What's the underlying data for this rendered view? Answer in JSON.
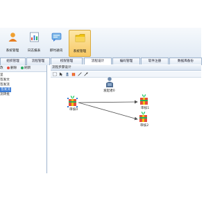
{
  "toolbar": {
    "buttons": [
      {
        "label": "系统管理",
        "icon": "user-icon"
      },
      {
        "label": "日志报表",
        "icon": "report-icon"
      },
      {
        "label": "即时通讯",
        "icon": "chat-icon"
      },
      {
        "label": "系统管理",
        "icon": "folder-icon",
        "active": true
      }
    ]
  },
  "tabs": [
    {
      "label": "组织管理"
    },
    {
      "label": "流程管理"
    },
    {
      "label": "权限管理"
    },
    {
      "label": "流程设计",
      "active": true
    },
    {
      "label": "编码管理"
    },
    {
      "label": "软件注册"
    },
    {
      "label": "数据库备份"
    }
  ],
  "left_panel": {
    "toolbar": [
      {
        "label": "改",
        "icon": "edit-icon"
      },
      {
        "label": "删除",
        "icon": "delete-icon"
      },
      {
        "label": "刷新",
        "icon": "refresh-icon"
      }
    ],
    "tree": [
      {
        "label": "呈"
      },
      {
        "label": "签发文"
      },
      {
        "label": "签发流"
      },
      {
        "label": "签发流",
        "selected": true
      },
      {
        "label": "流转批"
      }
    ]
  },
  "designer": {
    "title": "流程步骤设计",
    "tools": [
      "select-icon",
      "pointer-icon",
      "start-node-icon",
      "task-node-icon",
      "line-icon",
      "arrow-icon"
    ],
    "nodes": [
      {
        "id": "start",
        "label": "发起者0",
        "icon": "person-icon"
      },
      {
        "id": "a0",
        "label": "审核0",
        "icon": "gift-icon"
      },
      {
        "id": "a1",
        "label": "审核1",
        "icon": "gift-icon"
      },
      {
        "id": "a2",
        "label": "审核2",
        "icon": "gift-icon"
      }
    ],
    "edges": [
      {
        "from": "a0",
        "to": "a1"
      },
      {
        "from": "a0",
        "to": "a2"
      }
    ],
    "colors": {
      "edge": "#505050",
      "selection": "#3a7bd5"
    }
  }
}
